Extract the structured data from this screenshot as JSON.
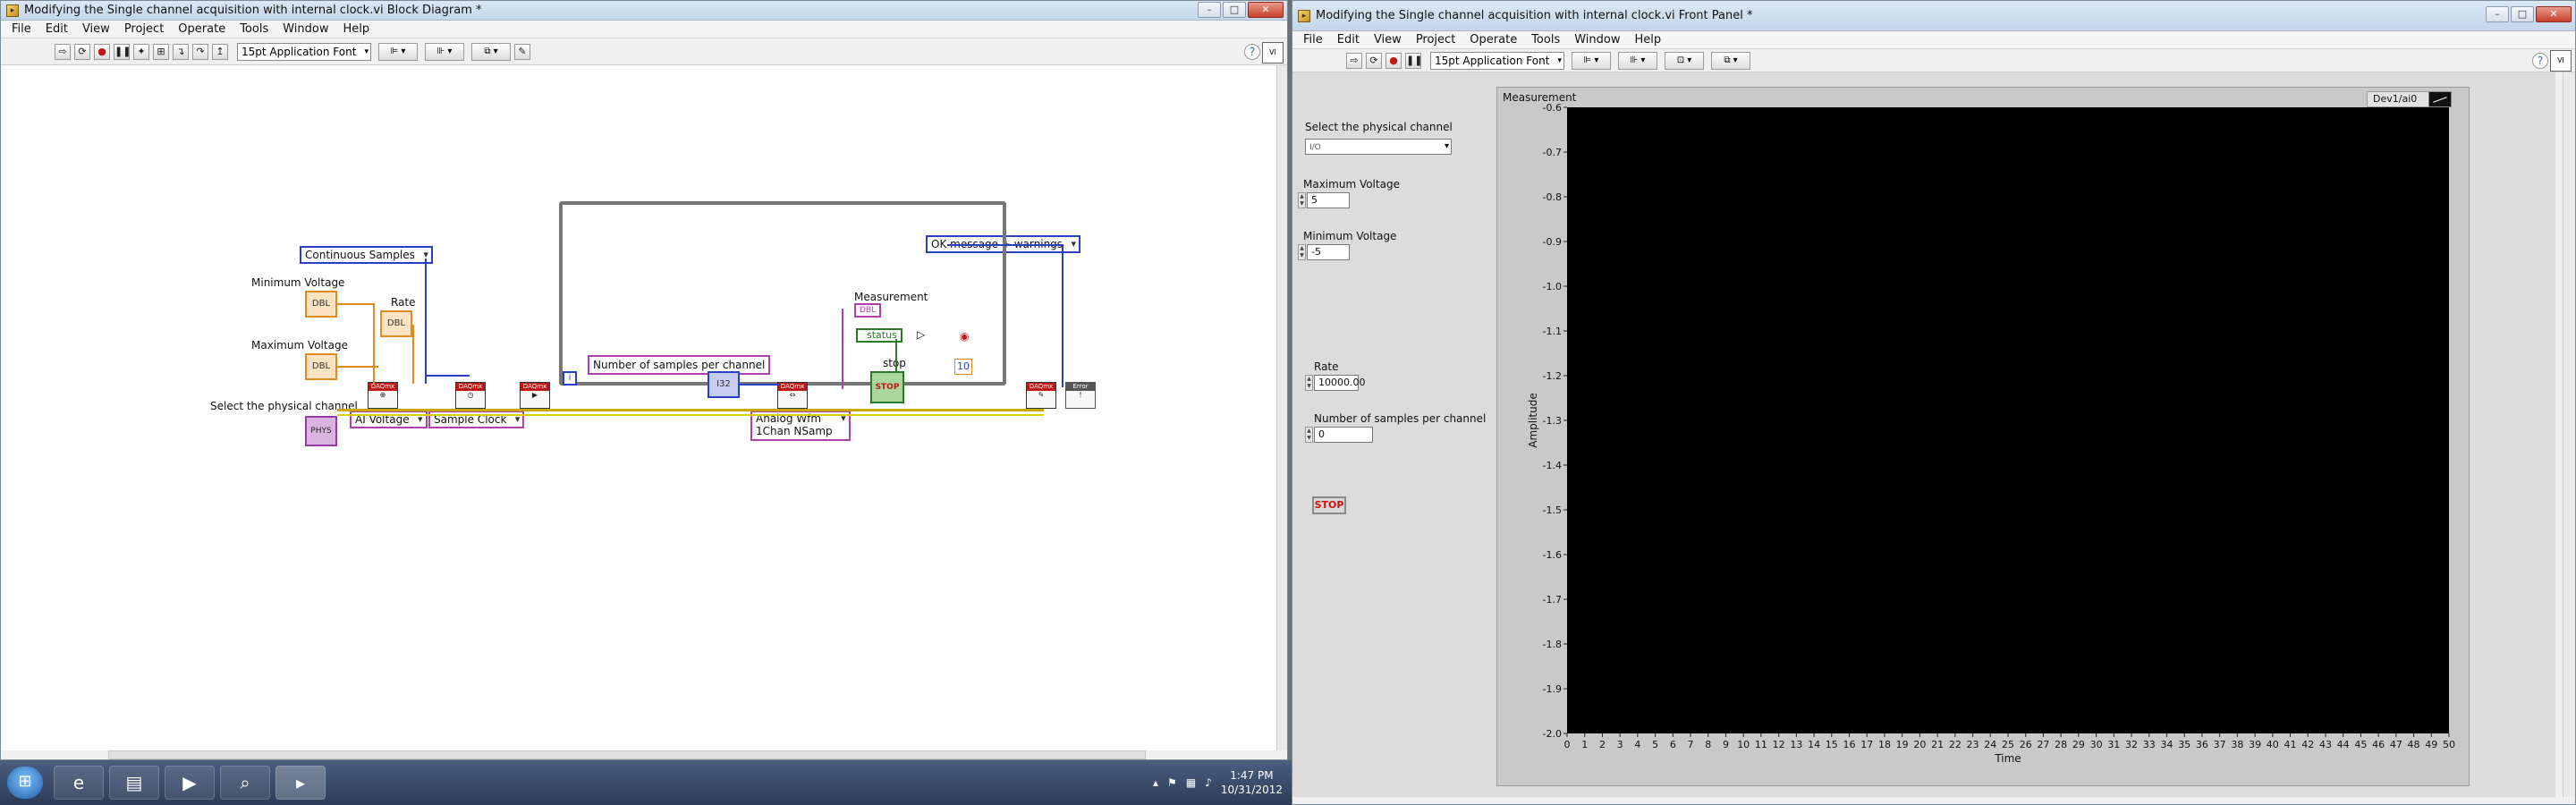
{
  "block_diagram_window": {
    "title": "Modifying the Single channel acquisition with internal clock.vi Block Diagram *",
    "menu": [
      "File",
      "Edit",
      "View",
      "Project",
      "Operate",
      "Tools",
      "Window",
      "Help"
    ],
    "font_selector": "15pt Application Font",
    "labels": {
      "min_voltage": "Minimum Voltage",
      "max_voltage": "Maximum Voltage",
      "rate": "Rate",
      "physical_channel": "Select the physical channel",
      "samples_per_channel": "Number of samples per channel",
      "measurement": "Measurement",
      "stop": "stop",
      "status": "status"
    },
    "constants": {
      "continuous_samples": "Continuous Samples",
      "ok_message": "OK message + warnings",
      "ai_voltage": "AI Voltage",
      "sample_clock": "Sample Clock",
      "analog_wfm_line1": "Analog Wfm",
      "analog_wfm_line2": "1Chan NSamp",
      "loop_count": "10"
    },
    "terminals": {
      "numeric": "I32",
      "dbl": "DBL",
      "channel": "PHYS",
      "stop": "STOP",
      "daqmx": "DAQmx",
      "error": "Error",
      "iteration": "i"
    }
  },
  "front_panel_window": {
    "title": "Modifying the Single channel acquisition with internal clock.vi Front Panel *",
    "menu": [
      "File",
      "Edit",
      "View",
      "Project",
      "Operate",
      "Tools",
      "Window",
      "Help"
    ],
    "font_selector": "15pt Application Font",
    "controls": {
      "physical_channel_label": "Select the physical channel",
      "physical_channel_value": "",
      "max_voltage_label": "Maximum Voltage",
      "max_voltage_value": "5",
      "min_voltage_label": "Minimum Voltage",
      "min_voltage_value": "-5",
      "rate_label": "Rate",
      "rate_value": "10000.00",
      "samples_label": "Number of samples per channel",
      "samples_value": "0",
      "stop_label": "STOP"
    },
    "graph": {
      "title": "Measurement",
      "legend": "Dev1/ai0",
      "plot_bg": "#000000"
    }
  },
  "chart_data": {
    "type": "line",
    "title": "Measurement",
    "xlabel": "Time",
    "ylabel": "Amplitude",
    "xlim": [
      0,
      50
    ],
    "ylim": [
      -2.0,
      -0.6
    ],
    "x_ticks": [
      0,
      1,
      2,
      3,
      4,
      5,
      6,
      7,
      8,
      9,
      10,
      11,
      12,
      13,
      14,
      15,
      16,
      17,
      18,
      19,
      20,
      21,
      22,
      23,
      24,
      25,
      26,
      27,
      28,
      29,
      30,
      31,
      32,
      33,
      34,
      35,
      36,
      37,
      38,
      39,
      40,
      41,
      42,
      43,
      44,
      45,
      46,
      47,
      48,
      49,
      50
    ],
    "y_ticks": [
      "-0.6",
      "-0.7",
      "-0.8",
      "-0.9",
      "-1.0",
      "-1.1",
      "-1.2",
      "-1.3",
      "-1.4",
      "-1.5",
      "-1.6",
      "-1.7",
      "-1.8",
      "-1.9",
      "-2.0"
    ],
    "series": [
      {
        "name": "Dev1/ai0",
        "x": [],
        "y": []
      }
    ],
    "grid": false,
    "legend": "top-right"
  },
  "taskbar": {
    "time": "1:47 PM",
    "date": "10/31/2012"
  }
}
